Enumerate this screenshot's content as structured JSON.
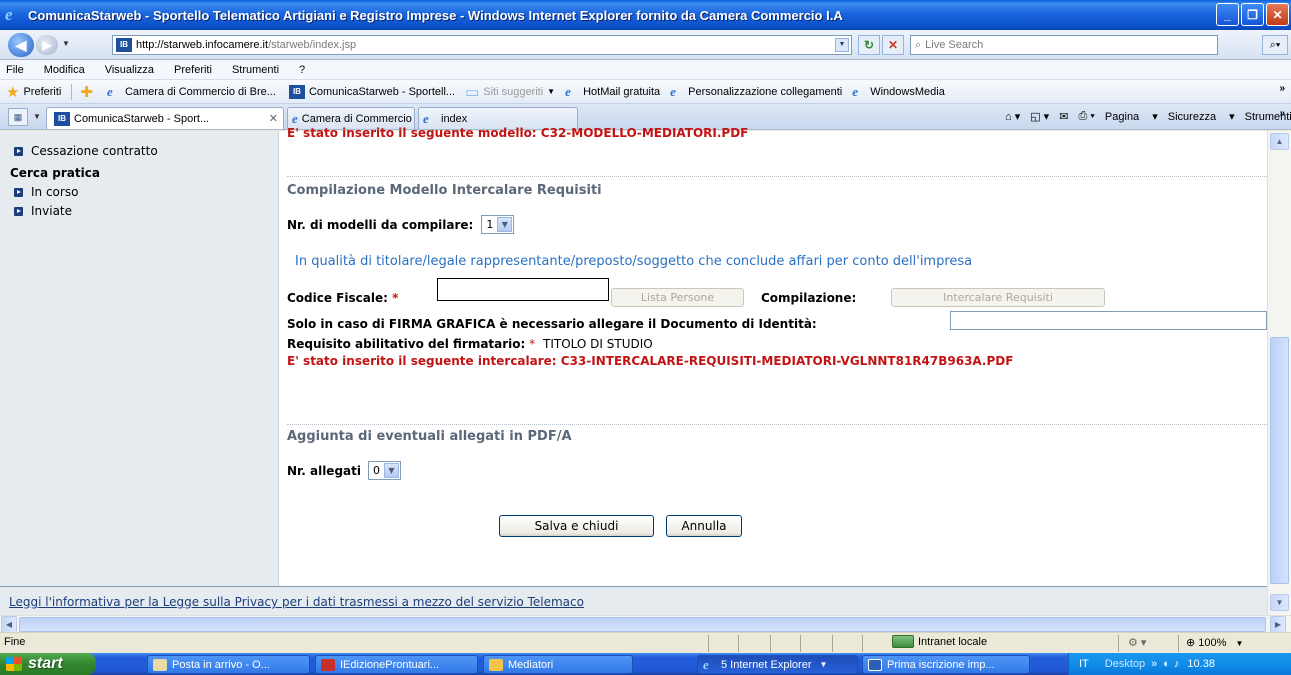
{
  "window": {
    "title": "ComunicaStarweb - Sportello Telematico Artigiani e Registro Imprese - Windows Internet Explorer fornito da Camera Commercio I.A"
  },
  "address": {
    "url_main": "http://starweb.infocamere.it",
    "url_rest": "/starweb/index.jsp",
    "search_placeholder": "Live Search"
  },
  "menu": [
    "File",
    "Modifica",
    "Visualizza",
    "Preferiti",
    "Strumenti",
    "?"
  ],
  "favorites": {
    "label": "Preferiti",
    "items": [
      "Camera di Commercio di Bre...",
      "ComunicaStarweb - Sportell...",
      "Siti suggeriti",
      "HotMail gratuita",
      "Personalizzazione collegamenti",
      "WindowsMedia"
    ]
  },
  "tabs": [
    "ComunicaStarweb - Sport...",
    "Camera di Commercio di Bres...",
    "index"
  ],
  "commandbar": [
    "Pagina",
    "Sicurezza",
    "Strumenti"
  ],
  "sidebar": {
    "top_item": "Cessazione contratto",
    "section": "Cerca pratica",
    "items": [
      "In corso",
      "Inviate"
    ]
  },
  "form": {
    "top_message": "E' stato inserito il seguente modello: C32-MODELLO-MEDIATORI.PDF",
    "section1_title": "Compilazione Modello Intercalare Requisiti",
    "nr_modelli_label": "Nr. di modelli da compilare:",
    "nr_modelli_value": "1",
    "qualita_text": "In qualità di titolare/legale rappresentante/preposto/soggetto che conclude affari per conto dell'impresa",
    "codice_fiscale_label": "Codice Fiscale:",
    "required_mark": "*",
    "codice_fiscale_value": "",
    "lista_persone_label": "Lista Persone",
    "compilazione_label": "Compilazione:",
    "intercalare_button_label": "Intercalare Requisiti",
    "firma_label": "Solo in caso di FIRMA GRAFICA è necessario allegare il Documento di Identità:",
    "firma_value": "",
    "requisito_label": "Requisito abilitativo del firmatario:",
    "requisito_value": "TITOLO DI STUDIO",
    "intercalare_message": "E' stato inserito il seguente intercalare: C33-INTERCALARE-REQUISITI-MEDIATORI-VGLNNT81R47B963A.PDF",
    "section2_title": "Aggiunta di eventuali allegati in PDF/A",
    "nr_allegati_label": "Nr. allegati",
    "nr_allegati_value": "0",
    "save_label": "Salva e chiudi",
    "cancel_label": "Annulla",
    "privacy_link": "Leggi l'informativa per la Legge sulla Privacy per i dati trasmessi a mezzo del servizio Telemaco"
  },
  "statusbar": {
    "status": "Fine",
    "zone": "Intranet locale",
    "zoom": "100%"
  },
  "taskbar": {
    "start": "start",
    "tasks": [
      "Posta in arrivo - O...",
      "IEdizioneProntuari...",
      "Mediatori",
      "5 Internet Explorer",
      "Prima iscrizione imp..."
    ],
    "lang": "IT",
    "desktop": "Desktop",
    "clock": "10.38"
  }
}
